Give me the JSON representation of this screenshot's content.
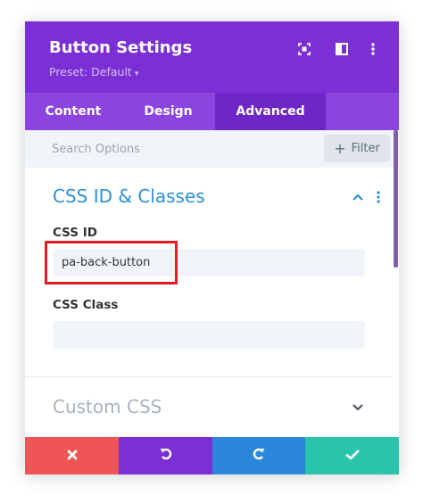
{
  "panel": {
    "title": "Button Settings",
    "preset_label": "Preset: Default",
    "preset_caret": "▾"
  },
  "tabs": [
    {
      "label": "Content",
      "active": false
    },
    {
      "label": "Design",
      "active": false
    },
    {
      "label": "Advanced",
      "active": true
    }
  ],
  "search": {
    "placeholder": "Search Options",
    "filter_plus": "+",
    "filter_label": "Filter"
  },
  "sections": {
    "css_id_classes": {
      "title": "CSS ID & Classes",
      "expanded": true,
      "css_id": {
        "label": "CSS ID",
        "value": "pa-back-button"
      },
      "css_class": {
        "label": "CSS Class",
        "value": ""
      }
    },
    "custom_css": {
      "title": "Custom CSS",
      "expanded": false
    }
  },
  "icons": {
    "header": [
      "expand-icon",
      "sidebar-layout-icon",
      "more-vertical-icon"
    ],
    "footer": [
      "close-icon",
      "undo-icon",
      "redo-icon",
      "check-icon"
    ]
  },
  "colors": {
    "header_bg": "#7b2fd4",
    "tabs_bg": "#8c44e0",
    "active_tab_bg": "#6f26c6",
    "section_title": "#2d8fd9",
    "highlight_border": "#e31b23",
    "footer_cancel": "#ef5555",
    "footer_undo": "#7b2fd4",
    "footer_redo": "#2b87da",
    "footer_save": "#29c4a9"
  }
}
